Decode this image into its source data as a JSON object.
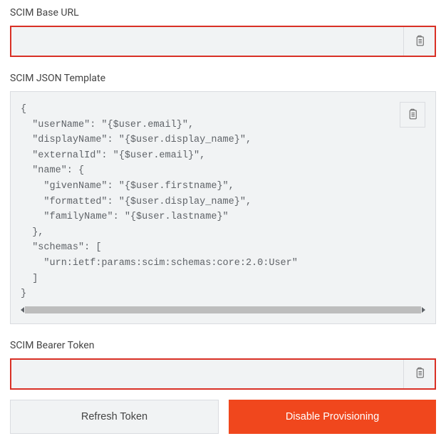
{
  "scim_base_url": {
    "label": "SCIM Base URL",
    "value": ""
  },
  "scim_json_template": {
    "label": "SCIM JSON Template",
    "value": "{\n  \"userName\": \"{$user.email}\",\n  \"displayName\": \"{$user.display_name}\",\n  \"externalId\": \"{$user.email}\",\n  \"name\": {\n    \"givenName\": \"{$user.firstname}\",\n    \"formatted\": \"{$user.display_name}\",\n    \"familyName\": \"{$user.lastname}\"\n  },\n  \"schemas\": [\n    \"urn:ietf:params:scim:schemas:core:2.0:User\"\n  ]\n}"
  },
  "scim_bearer_token": {
    "label": "SCIM Bearer Token",
    "value": ""
  },
  "buttons": {
    "refresh_token": "Refresh Token",
    "disable_provisioning": "Disable Provisioning"
  }
}
